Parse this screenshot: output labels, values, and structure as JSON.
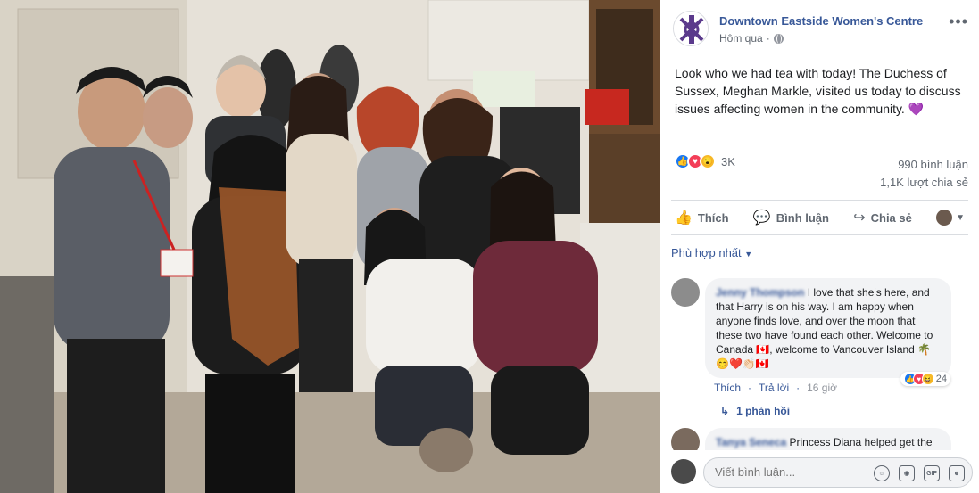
{
  "post": {
    "page_name": "Downtown Eastside Women's Centre",
    "timestamp": "Hôm qua",
    "more_label": "•••",
    "text": "Look who we had tea with today! The Duchess of Sussex, Meghan Markle, visited us today to discuss issues affecting women in the community.",
    "text_emoji": "💜"
  },
  "reactions": {
    "count": "3K",
    "icons": [
      "like-icon",
      "love-icon",
      "wow-icon"
    ],
    "comments_count": "990 bình luận",
    "shares_count": "1,1K lượt chia sẻ"
  },
  "actions": {
    "like": "Thích",
    "comment": "Bình luận",
    "share": "Chia sẻ"
  },
  "sort_label": "Phù hợp nhất",
  "comments": [
    {
      "author": "Jenny Thompson",
      "text": "I love that she's here, and that Harry is on his way. I am happy when anyone finds love, and over the moon that these two have found each other. Welcome to Canada 🇨🇦, welcome to Vancouver Island 🌴😊❤️👏🏻🇨🇦",
      "reaction_count": "24",
      "like_label": "Thích",
      "reply_label": "Trả lời",
      "time": "16 giờ",
      "replies_label": "1 phản hồi"
    },
    {
      "author": "Tanya Seneca",
      "text": "Princess Diana helped get the Family Center Society"
    }
  ],
  "composer": {
    "placeholder": "Viết bình luận..."
  },
  "colors": {
    "link": "#385898",
    "like": "#1877f2",
    "love": "#f33e58",
    "wow": "#f7b928"
  }
}
